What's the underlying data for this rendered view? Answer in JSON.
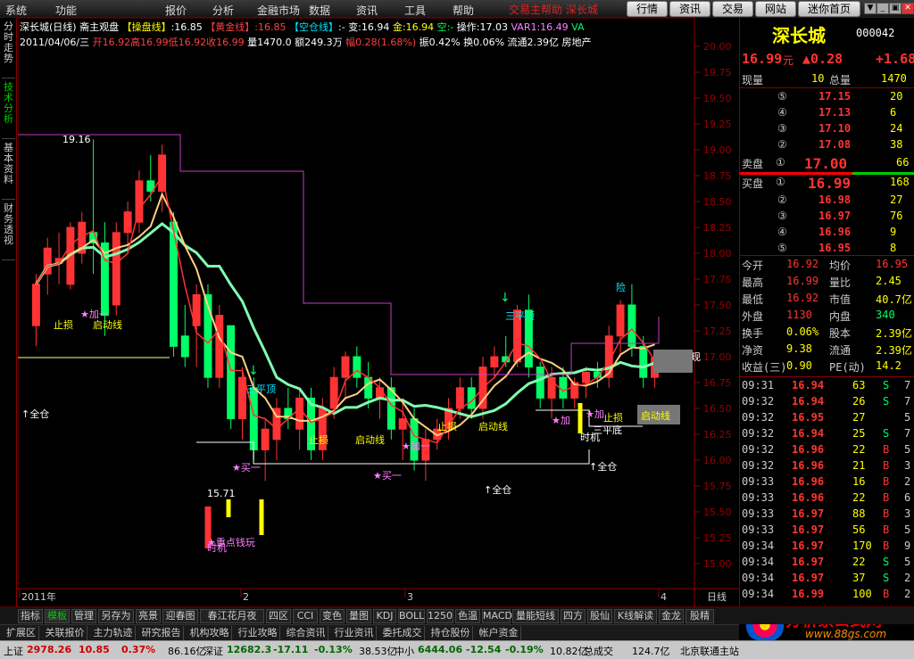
{
  "menu": {
    "items": [
      "系统",
      "功能",
      "报价",
      "分析",
      "金融市场",
      "数据",
      "资讯",
      "工具",
      "帮助"
    ],
    "title_text": "交易主帮助 深长城",
    "nav_buttons": [
      "行情",
      "资讯",
      "交易",
      "网站",
      "迷你首页"
    ],
    "window_buttons": [
      "▼",
      "_",
      "▣",
      "✕"
    ]
  },
  "left_tabs": [
    "分时走势",
    "技术分析",
    "基本资料",
    "财务透视"
  ],
  "chart_header": {
    "stock": "深长城(日线)",
    "formula": "斋主观盘",
    "ind_cao_label": "【操盘线】",
    "ind_cao_value": ":16.85",
    "ind_huang_label": "【黄金线】",
    "ind_huang_value": ":16.85",
    "ind_kong_label": "【空仓线】",
    "ind_kong_value": ":-",
    "bian": "变:16.94",
    "jin": "金:16.94",
    "kong": "空:-",
    "caozuo": "操作:17.03",
    "var1": "VAR1:16.49",
    "va": "VA",
    "date": "2011/04/06/三",
    "open": "开16.92",
    "high": "高16.99",
    "low": "低16.92",
    "close": "收16.99",
    "vol": "量1470.0",
    "amt": "额249.3万",
    "range": "幅0.28(1.68%)",
    "zhen": "振0.42%",
    "huan": "换0.06%",
    "liutong": "流通2.39亿",
    "sector": "房地产"
  },
  "chart_data": {
    "type": "candlestick",
    "y_axis": [
      "20.00",
      "19.75",
      "19.50",
      "19.25",
      "19.00",
      "18.75",
      "18.50",
      "18.25",
      "18.00",
      "17.75",
      "17.50",
      "17.25",
      "17.00",
      "16.75",
      "16.50",
      "16.25",
      "16.00",
      "15.75",
      "15.50",
      "15.25",
      "15.00"
    ],
    "x_labels": [
      "2011年",
      "2",
      "3",
      "4"
    ],
    "period": "日线",
    "candles": [
      {
        "o": 17.3,
        "h": 17.8,
        "l": 17.1,
        "c": 17.7,
        "type": "up"
      },
      {
        "o": 17.8,
        "h": 18.15,
        "l": 17.6,
        "c": 18.05,
        "type": "up"
      },
      {
        "o": 17.9,
        "h": 18.2,
        "l": 17.7,
        "c": 17.95,
        "type": "down"
      },
      {
        "o": 17.7,
        "h": 18.3,
        "l": 17.65,
        "c": 18.25,
        "type": "up"
      },
      {
        "o": 18.0,
        "h": 18.4,
        "l": 17.9,
        "c": 18.3,
        "type": "up"
      },
      {
        "o": 18.2,
        "h": 19.1,
        "l": 17.8,
        "c": 18.1,
        "type": "down"
      },
      {
        "o": 18.1,
        "h": 18.3,
        "l": 17.2,
        "c": 17.4,
        "type": "down"
      },
      {
        "o": 17.5,
        "h": 18.3,
        "l": 17.4,
        "c": 18.2,
        "type": "up"
      },
      {
        "o": 18.2,
        "h": 18.5,
        "l": 18.0,
        "c": 18.4,
        "type": "up"
      },
      {
        "o": 18.3,
        "h": 18.8,
        "l": 18.2,
        "c": 18.7,
        "type": "up"
      },
      {
        "o": 18.7,
        "h": 18.95,
        "l": 18.5,
        "c": 18.6,
        "type": "down"
      },
      {
        "o": 18.6,
        "h": 19.05,
        "l": 18.4,
        "c": 18.95,
        "type": "up"
      },
      {
        "o": 18.3,
        "h": 18.4,
        "l": 17.0,
        "c": 17.1,
        "type": "down"
      },
      {
        "o": 17.2,
        "h": 17.5,
        "l": 16.9,
        "c": 17.0,
        "type": "up"
      },
      {
        "o": 17.3,
        "h": 17.7,
        "l": 16.9,
        "c": 17.6,
        "type": "up"
      },
      {
        "o": 17.6,
        "h": 17.7,
        "l": 16.7,
        "c": 16.8,
        "type": "down"
      },
      {
        "o": 16.8,
        "h": 17.5,
        "l": 16.7,
        "c": 17.4,
        "type": "up"
      },
      {
        "o": 17.3,
        "h": 17.3,
        "l": 16.3,
        "c": 16.4,
        "type": "down"
      },
      {
        "o": 16.4,
        "h": 16.9,
        "l": 16.2,
        "c": 16.8,
        "type": "up"
      },
      {
        "o": 16.7,
        "h": 16.8,
        "l": 16.0,
        "c": 16.1,
        "type": "down"
      },
      {
        "o": 16.1,
        "h": 16.4,
        "l": 15.8,
        "c": 16.3,
        "type": "up"
      },
      {
        "o": 16.2,
        "h": 16.6,
        "l": 16.0,
        "c": 16.5,
        "type": "up"
      },
      {
        "o": 16.5,
        "h": 16.7,
        "l": 16.3,
        "c": 16.4,
        "type": "down"
      },
      {
        "o": 16.3,
        "h": 16.7,
        "l": 16.1,
        "c": 16.6,
        "type": "up"
      },
      {
        "o": 16.6,
        "h": 16.7,
        "l": 16.0,
        "c": 16.1,
        "type": "down"
      },
      {
        "o": 16.1,
        "h": 16.6,
        "l": 16.0,
        "c": 16.5,
        "type": "up"
      },
      {
        "o": 16.5,
        "h": 16.9,
        "l": 16.4,
        "c": 16.8,
        "type": "up"
      },
      {
        "o": 16.8,
        "h": 17.05,
        "l": 16.6,
        "c": 17.0,
        "type": "up"
      },
      {
        "o": 17.0,
        "h": 17.1,
        "l": 16.7,
        "c": 16.8,
        "type": "down"
      },
      {
        "o": 16.8,
        "h": 16.95,
        "l": 16.5,
        "c": 16.6,
        "type": "down"
      },
      {
        "o": 16.6,
        "h": 16.8,
        "l": 16.4,
        "c": 16.7,
        "type": "up"
      },
      {
        "o": 16.7,
        "h": 16.8,
        "l": 16.2,
        "c": 16.3,
        "type": "down"
      },
      {
        "o": 16.3,
        "h": 16.6,
        "l": 16.0,
        "c": 16.4,
        "type": "up"
      },
      {
        "o": 16.4,
        "h": 16.5,
        "l": 15.9,
        "c": 16.0,
        "type": "down"
      },
      {
        "o": 16.0,
        "h": 16.3,
        "l": 15.8,
        "c": 16.2,
        "type": "up"
      },
      {
        "o": 16.2,
        "h": 16.4,
        "l": 16.1,
        "c": 16.3,
        "type": "up"
      },
      {
        "o": 16.3,
        "h": 16.6,
        "l": 16.2,
        "c": 16.5,
        "type": "up"
      },
      {
        "o": 16.5,
        "h": 16.8,
        "l": 16.4,
        "c": 16.7,
        "type": "up"
      },
      {
        "o": 16.7,
        "h": 16.8,
        "l": 16.4,
        "c": 16.5,
        "type": "down"
      },
      {
        "o": 16.5,
        "h": 17.0,
        "l": 16.4,
        "c": 16.9,
        "type": "up"
      },
      {
        "o": 16.9,
        "h": 17.1,
        "l": 16.8,
        "c": 17.0,
        "type": "up"
      },
      {
        "o": 17.0,
        "h": 17.2,
        "l": 16.9,
        "c": 16.95,
        "type": "down"
      },
      {
        "o": 16.95,
        "h": 17.5,
        "l": 16.9,
        "c": 17.45,
        "type": "up"
      },
      {
        "o": 17.45,
        "h": 17.6,
        "l": 16.8,
        "c": 16.9,
        "type": "down"
      },
      {
        "o": 16.9,
        "h": 16.95,
        "l": 16.5,
        "c": 16.6,
        "type": "down"
      },
      {
        "o": 16.6,
        "h": 16.9,
        "l": 16.4,
        "c": 16.8,
        "type": "up"
      },
      {
        "o": 16.8,
        "h": 16.9,
        "l": 16.5,
        "c": 16.6,
        "type": "down"
      },
      {
        "o": 16.6,
        "h": 16.8,
        "l": 16.5,
        "c": 16.75,
        "type": "up"
      },
      {
        "o": 16.75,
        "h": 16.9,
        "l": 16.6,
        "c": 16.85,
        "type": "up"
      },
      {
        "o": 16.85,
        "h": 16.95,
        "l": 16.7,
        "c": 16.8,
        "type": "down"
      },
      {
        "o": 16.8,
        "h": 17.3,
        "l": 16.7,
        "c": 17.2,
        "type": "up"
      },
      {
        "o": 17.2,
        "h": 17.55,
        "l": 17.0,
        "c": 17.5,
        "type": "up"
      },
      {
        "o": 17.5,
        "h": 17.7,
        "l": 17.0,
        "c": 17.1,
        "type": "down"
      },
      {
        "o": 17.1,
        "h": 17.2,
        "l": 16.7,
        "c": 16.8,
        "type": "down"
      },
      {
        "o": 16.8,
        "h": 16.99,
        "l": 16.7,
        "c": 16.99,
        "type": "up"
      }
    ]
  },
  "annotations": {
    "high_label": "19.16",
    "low_label": "15.71",
    "quan_cang1": "↑全仓",
    "quan_cang2": "↑全仓",
    "quan_cang3": "↑全仓",
    "zhisun1": "止损",
    "zhisun2": "止损",
    "zhisun3": "止损",
    "zhisun4": "止损",
    "qidong1": "启动线",
    "qidong2": "启动线",
    "qidong3": "启动线",
    "qidong4": "启动线",
    "jia1": "★加一",
    "jia2": "★加一",
    "jia3": "★加",
    "jia4": "★加",
    "jia5": "★加",
    "sanpingding": "三平顶",
    "sanpingding2": "三平顶",
    "sanpingdi": "三平底",
    "mai_yi": "★买一",
    "mai_yi2": "★买一",
    "shi_ji1": "时机",
    "shi_ji2": "时机",
    "zhongdian": "★重点钱玩",
    "xian": "险",
    "xian_label": "现",
    "arrow_down": "↓"
  },
  "quote": {
    "name": "深长城",
    "code": "000042",
    "price": "16.99",
    "price_unit": "元",
    "change": "▲0.28",
    "change_pct": "+1.68",
    "xianliang_label": "现量",
    "xianliang": "10",
    "zongliang_label": "总量",
    "zongliang": "1470",
    "sell": [
      {
        "n": "⑤",
        "p": "17.15",
        "v": "20"
      },
      {
        "n": "④",
        "p": "17.13",
        "v": "6"
      },
      {
        "n": "③",
        "p": "17.10",
        "v": "24"
      },
      {
        "n": "②",
        "p": "17.08",
        "v": "38"
      }
    ],
    "sell1_label": "卖盘",
    "sell1_n": "①",
    "sell1_p": "17.00",
    "sell1_v": "66",
    "buy1_label": "买盘",
    "buy1_n": "①",
    "buy1_p": "16.99",
    "buy1_v": "168",
    "buy": [
      {
        "n": "②",
        "p": "16.98",
        "v": "27"
      },
      {
        "n": "③",
        "p": "16.97",
        "v": "76"
      },
      {
        "n": "④",
        "p": "16.96",
        "v": "9"
      },
      {
        "n": "⑤",
        "p": "16.95",
        "v": "8"
      }
    ],
    "stats": [
      {
        "l1": "今开",
        "v1": "16.92",
        "l2": "均价",
        "v2": "16.95"
      },
      {
        "l1": "最高",
        "v1": "16.99",
        "l2": "量比",
        "v2": "2.45"
      },
      {
        "l1": "最低",
        "v1": "16.92",
        "l2": "市值",
        "v2": "40.7亿"
      },
      {
        "l1": "外盘",
        "v1": "1130",
        "l2": "内盘",
        "v2": "340"
      },
      {
        "l1": "换手",
        "v1": "0.06%",
        "l2": "股本",
        "v2": "2.39亿"
      },
      {
        "l1": "净资",
        "v1": "9.38",
        "l2": "流通",
        "v2": "2.39亿"
      },
      {
        "l1": "收益(三)",
        "v1": "0.90",
        "l2": "PE(动)",
        "v2": "14.2"
      }
    ],
    "ticks": [
      {
        "t": "09:31",
        "p": "16.94",
        "v": "63",
        "s": "S",
        "n": "7"
      },
      {
        "t": "09:32",
        "p": "16.94",
        "v": "26",
        "s": "S",
        "n": "7"
      },
      {
        "t": "09:32",
        "p": "16.95",
        "v": "27",
        "s": "",
        "n": "5"
      },
      {
        "t": "09:32",
        "p": "16.94",
        "v": "25",
        "s": "S",
        "n": "7"
      },
      {
        "t": "09:32",
        "p": "16.96",
        "v": "22",
        "s": "B",
        "n": "5"
      },
      {
        "t": "09:32",
        "p": "16.96",
        "v": "21",
        "s": "B",
        "n": "3"
      },
      {
        "t": "09:33",
        "p": "16.96",
        "v": "16",
        "s": "B",
        "n": "2"
      },
      {
        "t": "09:33",
        "p": "16.96",
        "v": "22",
        "s": "B",
        "n": "6"
      },
      {
        "t": "09:33",
        "p": "16.97",
        "v": "88",
        "s": "B",
        "n": "3"
      },
      {
        "t": "09:33",
        "p": "16.97",
        "v": "56",
        "s": "B",
        "n": "5"
      },
      {
        "t": "09:34",
        "p": "16.97",
        "v": "170",
        "s": "B",
        "n": "9"
      },
      {
        "t": "09:34",
        "p": "16.97",
        "v": "22",
        "s": "S",
        "n": "5"
      },
      {
        "t": "09:34",
        "p": "16.97",
        "v": "37",
        "s": "S",
        "n": "2"
      },
      {
        "t": "09:34",
        "p": "16.99",
        "v": "100",
        "s": "B",
        "n": "2"
      }
    ]
  },
  "bottom_tabs": [
    "指标",
    "模板",
    "管理",
    "另存为",
    "亮景",
    "迎春图",
    "春江花月夜",
    "四区",
    "CCI",
    "变色",
    "量图",
    "KDJ",
    "BOLL",
    "1250",
    "色温",
    "MACD",
    "量能短线",
    "四方",
    "股仙",
    "K线解读",
    "金龙",
    "股精"
  ],
  "bottom_tabs2": [
    "扩展区",
    "关联报价",
    "主力轨迹",
    "研究报告",
    "机构攻略",
    "行业攻略",
    "综合资讯",
    "行业资讯",
    "委托成交",
    "持仓股份",
    "帐户资金"
  ],
  "status": {
    "sh_label": "上证",
    "sh_val": "2978.26",
    "sh_chg": "10.85",
    "sh_pct": "0.37%",
    "sh_amt": "86.16亿",
    "sz_label": "深证",
    "sz_val": "12682.3",
    "sz_chg": "-17.11",
    "sz_pct": "-0.13%",
    "sz_amt": "38.53亿",
    "zx_label": "中小",
    "zx_val": "6444.06",
    "zx_chg": "-12.54",
    "zx_pct": "-0.19%",
    "zx_amt": "10.82亿",
    "total_label": "总成交",
    "total_val": "124.7亿",
    "broker": "北京联通主站"
  },
  "brand": {
    "name": "分析家公式网",
    "url": "www.88gs.com"
  },
  "colors": {
    "up": "#ff3333",
    "down": "#00ff66",
    "pink": "#ff80ff",
    "yellow": "#ffff00",
    "cyan": "#00e5ff",
    "white": "#ffffff",
    "blue": "#0040ff",
    "magenta": "#c040c0"
  }
}
